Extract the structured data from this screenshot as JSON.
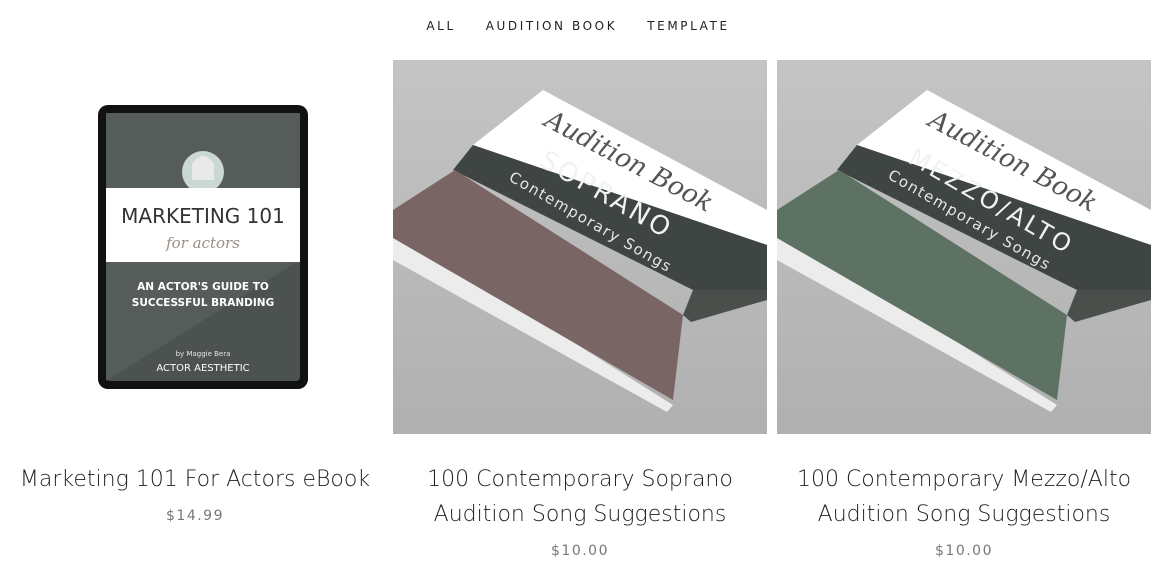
{
  "filters": [
    "ALL",
    "AUDITION BOOK",
    "TEMPLATE"
  ],
  "products": [
    {
      "title": "Marketing 101 For Actors eBook",
      "price": "$14.99",
      "cover": {
        "headline": "MARKETING 101",
        "script": "for actors",
        "subtitle_line1": "AN ACTOR'S GUIDE TO",
        "subtitle_line2": "SUCCESSFUL BRANDING",
        "byline": "by Maggie Bera",
        "brand": "ACTOR AESTHETIC"
      }
    },
    {
      "title_line1": "100 Contemporary Soprano",
      "title_line2": "Audition Song Suggestions",
      "price": "$10.00",
      "cover": {
        "script": "Audition Book",
        "voice": "SOPRANO",
        "sub": "Contemporary Songs",
        "binder_color": "#7a6565"
      }
    },
    {
      "title_line1": "100 Contemporary Mezzo/Alto",
      "title_line2": "Audition Song Suggestions",
      "price": "$10.00",
      "cover": {
        "script": "Audition Book",
        "voice": "MEZZO/ALTO",
        "sub": "Contemporary Songs",
        "binder_color": "#5e7264"
      }
    }
  ],
  "colors": {
    "band_dark": "#3c423f",
    "tablet_bg": "#4a4f4c",
    "photo_bg": "#bdbdbd"
  }
}
